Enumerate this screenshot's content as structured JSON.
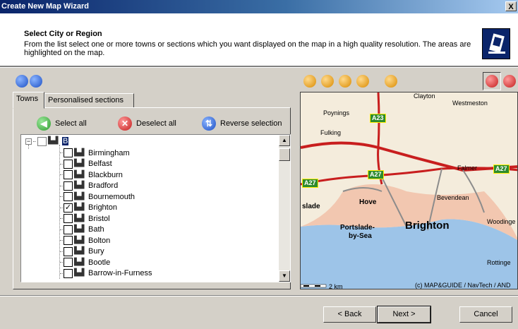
{
  "window": {
    "title": "Create New Map Wizard",
    "close_label": "X"
  },
  "header": {
    "title": "Select City or Region",
    "description": "From the list select one or more towns or sections which you want displayed on the map in a high quality resolution. The areas are highlighted on the map."
  },
  "tabs": [
    {
      "label": "Towns",
      "active": true
    },
    {
      "label": "Personalised sections",
      "active": false
    }
  ],
  "actions": {
    "select_all": "Select all",
    "deselect_all": "Deselect all",
    "reverse_selection": "Reverse selection"
  },
  "tree": {
    "root_expander": "−",
    "root_label": "B",
    "items": [
      {
        "label": "Birmingham",
        "checked": false
      },
      {
        "label": "Belfast",
        "checked": false
      },
      {
        "label": "Blackburn",
        "checked": false
      },
      {
        "label": "Bradford",
        "checked": false
      },
      {
        "label": "Bournemouth",
        "checked": false
      },
      {
        "label": "Brighton",
        "checked": true
      },
      {
        "label": "Bristol",
        "checked": false
      },
      {
        "label": "Bath",
        "checked": false
      },
      {
        "label": "Bolton",
        "checked": false
      },
      {
        "label": "Bury",
        "checked": false
      },
      {
        "label": "Bootle",
        "checked": false
      },
      {
        "label": "Barrow-in-Furness",
        "checked": false
      }
    ]
  },
  "map": {
    "labels": {
      "clayton": "Clayton",
      "westmeston": "Westmeston",
      "poynings": "Poynings",
      "fulking": "Fulking",
      "falmer": "Falmer",
      "bevendean": "Bevendean",
      "hove": "Hove",
      "slade": "slade",
      "portslade": "Portslade-",
      "by_sea": "by-Sea",
      "brighton": "Brighton",
      "woodingdean": "Woodinge",
      "rottingdean": "Rottinge"
    },
    "roads": {
      "a23": "A23",
      "a27_top": "A27",
      "a27_left": "A27",
      "a27_right": "A27"
    },
    "scale": "2 km",
    "copyright": "(c) MAP&GUIDE / NavTech / AND"
  },
  "buttons": {
    "back": "< Back",
    "next": "Next >",
    "cancel": "Cancel"
  },
  "colors": {
    "sea": "#9dc4e8",
    "urban": "#f2c7b0",
    "road_red": "#c81e1e",
    "road_green": "#2e8b2e",
    "tree_bg": "#ffffff"
  }
}
